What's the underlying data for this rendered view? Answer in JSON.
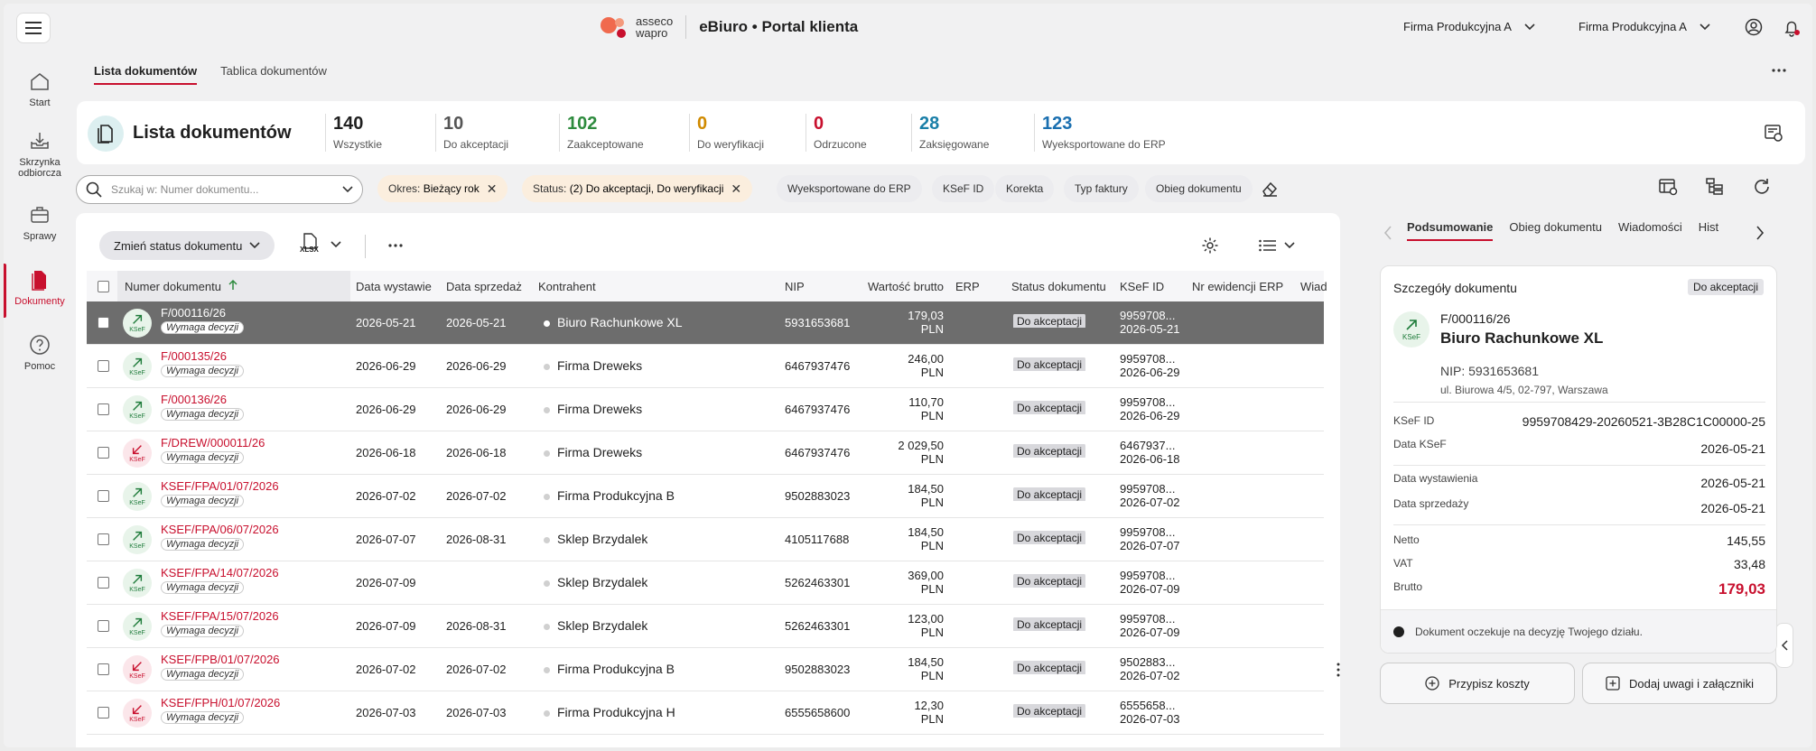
{
  "header": {
    "logo_line1": "asseco",
    "logo_line2": "wapro",
    "app_title": "eBiuro • Portal klienta",
    "company_select_1": "Firma Produkcyjna A",
    "company_select_2": "Firma Produkcyjna A"
  },
  "sidebar": {
    "items": [
      {
        "label": "Start",
        "icon": "home-icon"
      },
      {
        "label": "Skrzynka odbiorcza",
        "icon": "inbox-icon"
      },
      {
        "label": "Sprawy",
        "icon": "briefcase-icon"
      },
      {
        "label": "Dokumenty",
        "icon": "document-icon",
        "active": true
      },
      {
        "label": "Pomoc",
        "icon": "help-icon"
      }
    ]
  },
  "tabs": [
    {
      "label": "Lista dokumentów",
      "active": true
    },
    {
      "label": "Tablica dokumentów",
      "active": false
    }
  ],
  "summary": {
    "title": "Lista dokumentów",
    "stats": [
      {
        "value": "140",
        "label": "Wszystkie",
        "color": "#1f1f1f"
      },
      {
        "value": "10",
        "label": "Do akceptacji",
        "color": "#555555"
      },
      {
        "value": "102",
        "label": "Zaakceptowane",
        "color": "#2e8b3e"
      },
      {
        "value": "0",
        "label": "Do weryfikacji",
        "color": "#d08a00"
      },
      {
        "value": "0",
        "label": "Odrzucone",
        "color": "#c8102e"
      },
      {
        "value": "28",
        "label": "Zaksięgowane",
        "color": "#1a7fa8"
      },
      {
        "value": "123",
        "label": "Wyeksportowane do ERP",
        "color": "#1a6fb0"
      }
    ]
  },
  "filters": {
    "search_placeholder": "Szukaj w: Numer dokumentu...",
    "chip_period_label": "Okres:",
    "chip_period_value": "Bieżący rok",
    "chip_status_label": "Status:",
    "chip_status_value": "(2) Do akceptacji, Do weryfikacji",
    "plain_chips": [
      "Wyeksportowane do ERP",
      "KSeF ID",
      "Korekta",
      "Typ faktury",
      "Obieg dokumentu"
    ]
  },
  "toolbar": {
    "change_status": "Zmień status dokumentu",
    "xlsx": "XLSX"
  },
  "table": {
    "columns": [
      "Numer dokumentu",
      "Data wystawie",
      "Data sprzedaż",
      "Kontrahent",
      "NIP",
      "Wartość brutto",
      "ERP",
      "Status dokumentu",
      "KSeF ID",
      "Nr ewidencji ERP",
      "Wiad"
    ],
    "rows": [
      {
        "dir": "in",
        "num": "F/000116/26",
        "tag": "Wymaga decyzji",
        "d1": "2026-05-21",
        "d2": "2026-05-21",
        "contractor": "Biuro Rachunkowe XL",
        "nip": "5931653681",
        "amount": "179,03",
        "cur": "PLN",
        "status": "Do akceptacji",
        "ksef1": "9959708...",
        "ksef2": "2026-05-21",
        "selected": true
      },
      {
        "dir": "in",
        "num": "F/000135/26",
        "tag": "Wymaga decyzji",
        "d1": "2026-06-29",
        "d2": "2026-06-29",
        "contractor": "Firma Dreweks",
        "nip": "6467937476",
        "amount": "246,00",
        "cur": "PLN",
        "status": "Do akceptacji",
        "ksef1": "9959708...",
        "ksef2": "2026-06-29"
      },
      {
        "dir": "in",
        "num": "F/000136/26",
        "tag": "Wymaga decyzji",
        "d1": "2026-06-29",
        "d2": "2026-06-29",
        "contractor": "Firma Dreweks",
        "nip": "6467937476",
        "amount": "110,70",
        "cur": "PLN",
        "status": "Do akceptacji",
        "ksef1": "9959708...",
        "ksef2": "2026-06-29"
      },
      {
        "dir": "out",
        "num": "F/DREW/000011/26",
        "tag": "Wymaga decyzji",
        "d1": "2026-06-18",
        "d2": "2026-06-18",
        "contractor": "Firma Dreweks",
        "nip": "6467937476",
        "amount": "2 029,50",
        "cur": "PLN",
        "status": "Do akceptacji",
        "ksef1": "6467937...",
        "ksef2": "2026-06-18"
      },
      {
        "dir": "in",
        "num": "KSEF/FPA/01/07/2026",
        "tag": "Wymaga decyzji",
        "d1": "2026-07-02",
        "d2": "2026-07-02",
        "contractor": "Firma Produkcyjna B",
        "nip": "9502883023",
        "amount": "184,50",
        "cur": "PLN",
        "status": "Do akceptacji",
        "ksef1": "9959708...",
        "ksef2": "2026-07-02"
      },
      {
        "dir": "in",
        "num": "KSEF/FPA/06/07/2026",
        "tag": "Wymaga decyzji",
        "d1": "2026-07-07",
        "d2": "2026-08-31",
        "contractor": "Sklep Brzydalek",
        "nip": "4105117688",
        "amount": "184,50",
        "cur": "PLN",
        "status": "Do akceptacji",
        "ksef1": "9959708...",
        "ksef2": "2026-07-07"
      },
      {
        "dir": "in",
        "num": "KSEF/FPA/14/07/2026",
        "tag": "Wymaga decyzji",
        "d1": "2026-07-09",
        "d2": "",
        "contractor": "Sklep Brzydalek",
        "nip": "5262463301",
        "amount": "369,00",
        "cur": "PLN",
        "status": "Do akceptacji",
        "ksef1": "9959708...",
        "ksef2": "2026-07-09"
      },
      {
        "dir": "in",
        "num": "KSEF/FPA/15/07/2026",
        "tag": "Wymaga decyzji",
        "d1": "2026-07-09",
        "d2": "2026-08-31",
        "contractor": "Sklep Brzydalek",
        "nip": "5262463301",
        "amount": "123,00",
        "cur": "PLN",
        "status": "Do akceptacji",
        "ksef1": "9959708...",
        "ksef2": "2026-07-09"
      },
      {
        "dir": "out",
        "num": "KSEF/FPB/01/07/2026",
        "tag": "Wymaga decyzji",
        "d1": "2026-07-02",
        "d2": "2026-07-02",
        "contractor": "Firma Produkcyjna B",
        "nip": "9502883023",
        "amount": "184,50",
        "cur": "PLN",
        "status": "Do akceptacji",
        "ksef1": "9502883...",
        "ksef2": "2026-07-02"
      },
      {
        "dir": "out",
        "num": "KSEF/FPH/01/07/2026",
        "tag": "Wymaga decyzji",
        "d1": "2026-07-03",
        "d2": "2026-07-03",
        "contractor": "Firma Produkcyjna H",
        "nip": "6555658600",
        "amount": "12,30",
        "cur": "PLN",
        "status": "Do akceptacji",
        "ksef1": "6555658...",
        "ksef2": "2026-07-03"
      }
    ]
  },
  "detail": {
    "tabs": [
      "Podsumowanie",
      "Obieg dokumentu",
      "Wiadomości",
      "Hist"
    ],
    "title": "Szczegóły dokumentu",
    "status_badge": "Do akceptacji",
    "doc_number": "F/000116/26",
    "contractor": "Biuro Rachunkowe XL",
    "ksef_icon_label": "KSeF",
    "nip": "NIP: 5931653681",
    "address": "ul. Biurowa 4/5, 02-797, Warszawa",
    "fields": [
      {
        "k": "KSeF ID",
        "v": "9959708429-20260521-3B28C1C00000-25"
      },
      {
        "k": "Data KSeF",
        "v": "2026-05-21"
      },
      {
        "k": "Data wystawienia",
        "v": "2026-05-21"
      },
      {
        "k": "Data sprzedaży",
        "v": "2026-05-21"
      },
      {
        "k": "Netto",
        "v": "145,55"
      },
      {
        "k": "VAT",
        "v": "33,48"
      },
      {
        "k": "Brutto",
        "v": "179,03"
      }
    ],
    "note": "Dokument oczekuje na decyzję Twojego działu.",
    "btn_costs": "Przypisz koszty",
    "btn_notes": "Dodaj uwagi i załączniki"
  }
}
